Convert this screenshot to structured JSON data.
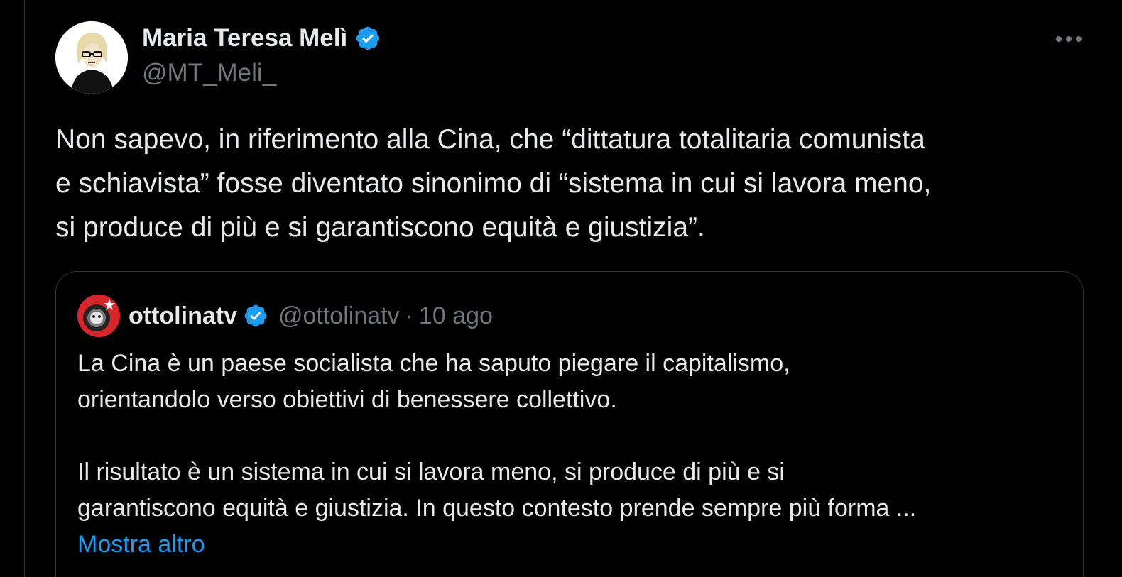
{
  "author": {
    "name": "Maria Teresa Melì",
    "handle": "@MT_Meli_",
    "verified_icon": "verified-badge-icon"
  },
  "tweet": {
    "lines": [
      "Non sapevo, in riferimento alla Cina, che “dittatura totalitaria comunista",
      "e schiavista” fosse diventato sinonimo di “sistema in cui si lavora meno,",
      "si produce di più e si garantiscono equità e giustizia”."
    ]
  },
  "quote": {
    "name": "ottolinatv",
    "handle": "@ottolinatv",
    "separator": "·",
    "time": "10 ago",
    "paragraph1": [
      "La Cina è un paese socialista che ha saputo piegare il capitalismo,",
      "orientandolo verso obiettivi di benessere collettivo."
    ],
    "paragraph2": [
      "Il risultato è un sistema in cui si lavora meno, si produce di più e si",
      "garantiscono equità e giustizia. In questo contesto prende sempre più  forma ..."
    ],
    "show_more": "Mostra altro"
  },
  "colors": {
    "background": "#000000",
    "text": "#e7e9ea",
    "secondary": "#71767b",
    "accent": "#1d9bf0",
    "border": "#2f3336"
  }
}
